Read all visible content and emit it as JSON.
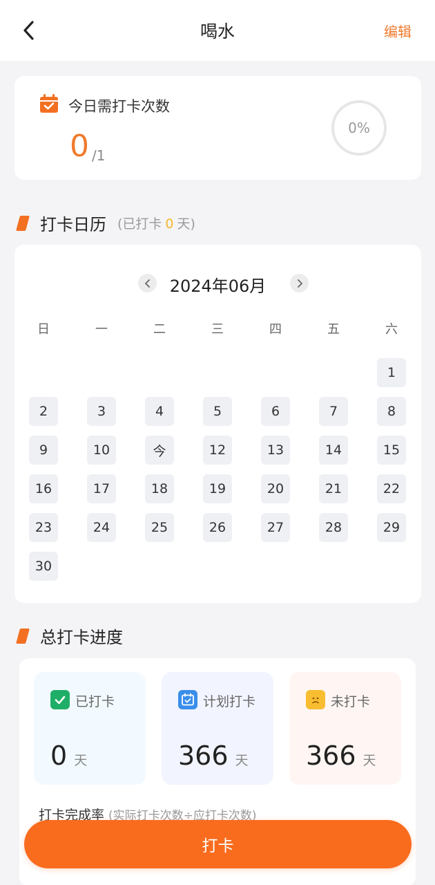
{
  "header": {
    "title": "喝水",
    "edit_label": "编辑"
  },
  "today": {
    "label": "今日需打卡次数",
    "count": "0",
    "total": "/1",
    "progress_text": "0%",
    "progress": 0
  },
  "calendar_section": {
    "title": "打卡日历",
    "sub_prefix": "(已打卡",
    "sub_count": "0",
    "sub_suffix": "天)"
  },
  "calendar": {
    "month_label": "2024年06月",
    "weekdays": [
      "日",
      "一",
      "二",
      "三",
      "四",
      "五",
      "六"
    ],
    "first_weekday": 6,
    "days": [
      "1",
      "2",
      "3",
      "4",
      "5",
      "6",
      "7",
      "8",
      "9",
      "10",
      "今",
      "12",
      "13",
      "14",
      "15",
      "16",
      "17",
      "18",
      "19",
      "20",
      "21",
      "22",
      "23",
      "24",
      "25",
      "26",
      "27",
      "28",
      "29",
      "30"
    ]
  },
  "progress_section": {
    "title": "总打卡进度"
  },
  "stats": [
    {
      "label": "已打卡",
      "value": "0",
      "unit": "天",
      "bg": "#f2faff",
      "icon_color": "#1fae67",
      "icon": "check-icon"
    },
    {
      "label": "计划打卡",
      "value": "366",
      "unit": "天",
      "bg": "#f2f4ff",
      "icon_color": "#3a8eea",
      "icon": "calendar-icon"
    },
    {
      "label": "未打卡",
      "value": "366",
      "unit": "天",
      "bg": "#fff6f3",
      "icon_color": "#f8bd30",
      "icon": "sad-face-icon"
    }
  ],
  "rate": {
    "label": "打卡完成率",
    "hint": "(实际打卡次数÷应打卡次数)"
  },
  "button": {
    "label": "打卡"
  },
  "colors": {
    "accent": "#f37022",
    "primary_button": "#f96c1e"
  }
}
